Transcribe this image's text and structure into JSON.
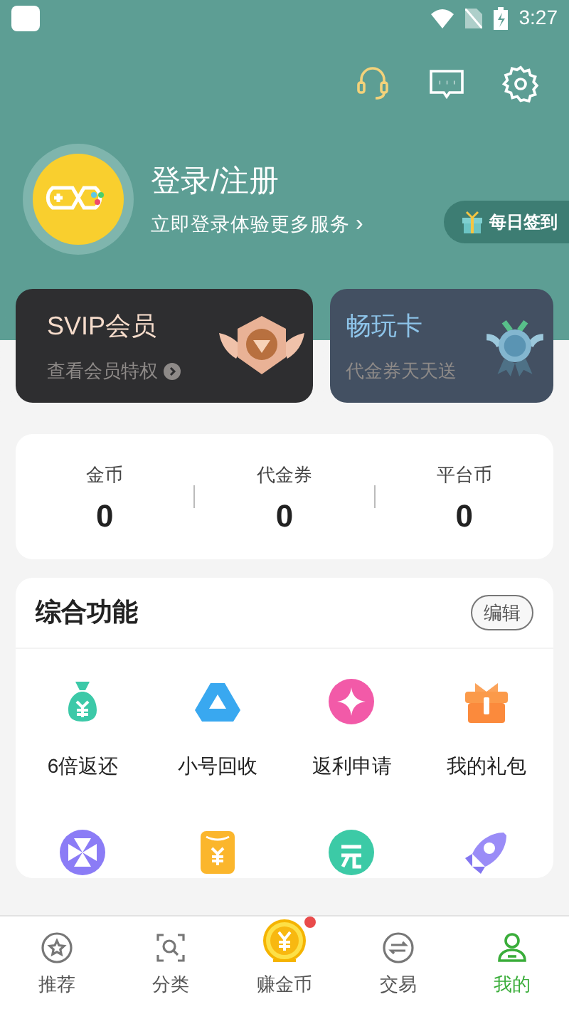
{
  "status_bar": {
    "time": "3:27"
  },
  "profile": {
    "title": "登录/注册",
    "subtitle": "立即登录体验更多服务",
    "chevron": "›",
    "daily_sign": "每日签到"
  },
  "member_cards": [
    {
      "kind": "svip",
      "title": "SVIP会员",
      "subtitle": "查看会员特权"
    },
    {
      "kind": "pass",
      "title": "畅玩卡",
      "subtitle": "代金券天天送"
    }
  ],
  "balances": [
    {
      "label": "金币",
      "value": "0"
    },
    {
      "label": "代金券",
      "value": "0"
    },
    {
      "label": "平台币",
      "value": "0"
    }
  ],
  "functions": {
    "title": "综合功能",
    "edit": "编辑",
    "items": [
      {
        "kind": "moneybag",
        "label": "6倍返还"
      },
      {
        "kind": "triangle",
        "label": "小号回收"
      },
      {
        "kind": "sparkle",
        "label": "返利申请"
      },
      {
        "kind": "gift",
        "label": "我的礼包"
      },
      {
        "kind": "pinwheel"
      },
      {
        "kind": "envelope"
      },
      {
        "kind": "exchange"
      },
      {
        "kind": "rocket"
      }
    ]
  },
  "tab_bar": [
    {
      "kind": "star",
      "label": "推荐",
      "selected": false,
      "badge": false
    },
    {
      "kind": "search",
      "label": "分类",
      "selected": false,
      "badge": false
    },
    {
      "kind": "coin",
      "label": "赚金币",
      "selected": false,
      "badge": true
    },
    {
      "kind": "swap",
      "label": "交易",
      "selected": false,
      "badge": false
    },
    {
      "kind": "person",
      "label": "我的",
      "selected": true,
      "badge": false
    }
  ]
}
